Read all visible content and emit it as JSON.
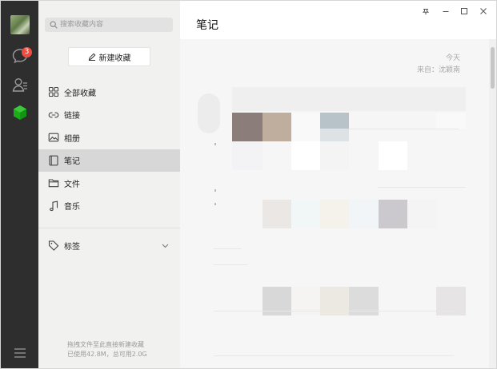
{
  "sidebar": {
    "search_placeholder": "搜索收藏内容",
    "new_button_label": "新建收藏",
    "items": [
      {
        "label": "全部收藏",
        "icon": "grid-icon"
      },
      {
        "label": "链接",
        "icon": "link-icon"
      },
      {
        "label": "相册",
        "icon": "image-icon"
      },
      {
        "label": "笔记",
        "icon": "note-icon",
        "active": true
      },
      {
        "label": "文件",
        "icon": "folder-icon"
      },
      {
        "label": "音乐",
        "icon": "music-icon"
      }
    ],
    "tags_label": "标签",
    "footer_line1": "拖拽文件至此直接新建收藏",
    "footer_line2": "已使用42.8M，总可用2.0G"
  },
  "iconbar": {
    "chat_badge": "3",
    "accent_color": "#1aad19"
  },
  "main": {
    "title": "笔记",
    "note_date": "今天",
    "note_source": "来自：沈颖南"
  },
  "window_controls": [
    "pin-icon",
    "minimize-icon",
    "maximize-icon",
    "close-icon"
  ]
}
